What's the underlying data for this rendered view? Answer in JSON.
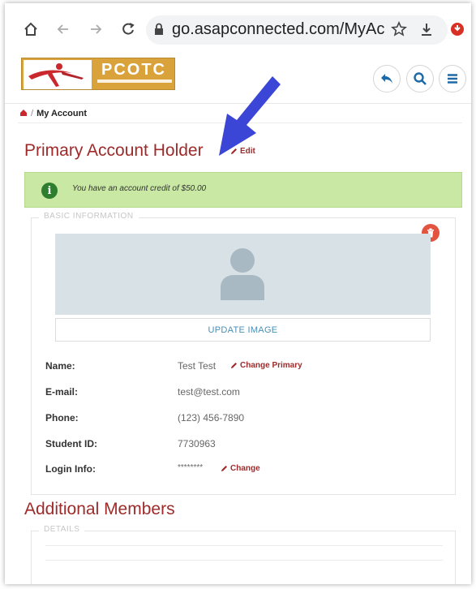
{
  "browser": {
    "url": "go.asapconnected.com/MyAccou"
  },
  "site": {
    "logo_text": "PCOTC"
  },
  "breadcrumb": {
    "separator": "/",
    "current": "My Account"
  },
  "account": {
    "title": "Primary Account Holder",
    "edit_label": "Edit",
    "alert_text": "You have an account credit of $50.00"
  },
  "basic_info": {
    "legend": "BASIC INFORMATION",
    "update_image_label": "UPDATE IMAGE",
    "fields": [
      {
        "label": "Name:",
        "value": "Test Test",
        "action": "Change Primary"
      },
      {
        "label": "E-mail:",
        "value": "test@test.com"
      },
      {
        "label": "Phone:",
        "value": "(123) 456-7890"
      },
      {
        "label": "Student ID:",
        "value": "7730963"
      },
      {
        "label": "Login Info:",
        "value": "********",
        "action": "Change"
      }
    ]
  },
  "members": {
    "title": "Additional Members",
    "legend": "DETAILS"
  },
  "colors": {
    "accent": "#9e2a2a",
    "alert_bg": "#c8e8a4",
    "annotation_arrow": "#3b45d6",
    "delete": "#e2543f"
  },
  "icons": [
    "home-icon",
    "back-arrow-icon",
    "forward-arrow-icon",
    "reload-icon",
    "lock-icon",
    "star-icon",
    "download-icon",
    "browser-menu-icon",
    "reply-icon",
    "search-icon",
    "hamburger-menu-icon",
    "breadcrumb-home-icon",
    "pencil-icon",
    "info-icon",
    "trash-icon",
    "user-placeholder-icon"
  ]
}
